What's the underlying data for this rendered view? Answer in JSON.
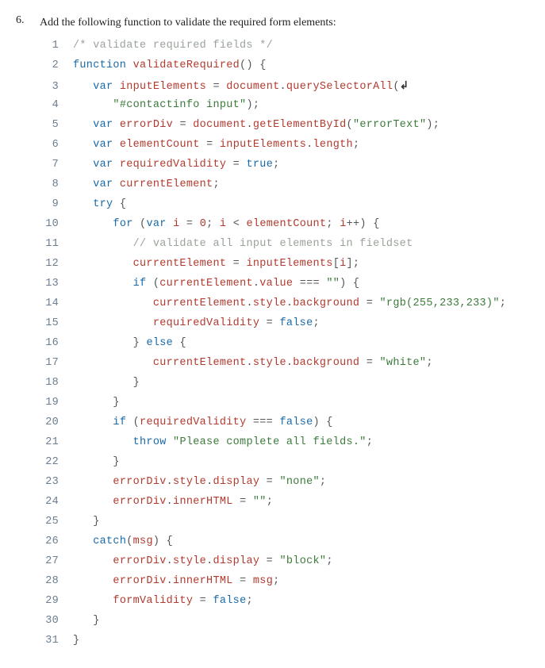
{
  "step": {
    "number": "6.",
    "instruction": "Add the following function to validate the required form elements:"
  },
  "code": {
    "lines": [
      {
        "n": "1",
        "tokens": [
          {
            "cls": "t-comment",
            "txt": "/* validate required fields */"
          }
        ]
      },
      {
        "n": "2",
        "tokens": [
          {
            "cls": "t-keyword",
            "txt": "function"
          },
          {
            "cls": "t-punct",
            "txt": " "
          },
          {
            "cls": "t-func",
            "txt": "validateRequired"
          },
          {
            "cls": "t-punct",
            "txt": "() {"
          }
        ]
      },
      {
        "n": "3",
        "tokens": [
          {
            "cls": "",
            "txt": "   "
          },
          {
            "cls": "t-var",
            "txt": "var"
          },
          {
            "cls": "t-punct",
            "txt": " "
          },
          {
            "cls": "t-ident",
            "txt": "inputElements"
          },
          {
            "cls": "t-punct",
            "txt": " = "
          },
          {
            "cls": "t-attr",
            "txt": "document"
          },
          {
            "cls": "t-punct",
            "txt": "."
          },
          {
            "cls": "t-attr",
            "txt": "querySelectorAll"
          },
          {
            "cls": "t-punct",
            "txt": "("
          },
          {
            "cls": "wrap-icon",
            "txt": "↲"
          }
        ]
      },
      {
        "n": "4",
        "tokens": [
          {
            "cls": "",
            "txt": "      "
          },
          {
            "cls": "t-str",
            "txt": "\"#contactinfo input\""
          },
          {
            "cls": "t-punct",
            "txt": ");"
          }
        ]
      },
      {
        "n": "5",
        "tokens": [
          {
            "cls": "",
            "txt": "   "
          },
          {
            "cls": "t-var",
            "txt": "var"
          },
          {
            "cls": "t-punct",
            "txt": " "
          },
          {
            "cls": "t-ident",
            "txt": "errorDiv"
          },
          {
            "cls": "t-punct",
            "txt": " = "
          },
          {
            "cls": "t-attr",
            "txt": "document"
          },
          {
            "cls": "t-punct",
            "txt": "."
          },
          {
            "cls": "t-attr",
            "txt": "getElementById"
          },
          {
            "cls": "t-punct",
            "txt": "("
          },
          {
            "cls": "t-str",
            "txt": "\"errorText\""
          },
          {
            "cls": "t-punct",
            "txt": ");"
          }
        ]
      },
      {
        "n": "6",
        "tokens": [
          {
            "cls": "",
            "txt": "   "
          },
          {
            "cls": "t-var",
            "txt": "var"
          },
          {
            "cls": "t-punct",
            "txt": " "
          },
          {
            "cls": "t-ident",
            "txt": "elementCount"
          },
          {
            "cls": "t-punct",
            "txt": " = "
          },
          {
            "cls": "t-attr",
            "txt": "inputElements"
          },
          {
            "cls": "t-punct",
            "txt": "."
          },
          {
            "cls": "t-attr",
            "txt": "length"
          },
          {
            "cls": "t-punct",
            "txt": ";"
          }
        ]
      },
      {
        "n": "7",
        "tokens": [
          {
            "cls": "",
            "txt": "   "
          },
          {
            "cls": "t-var",
            "txt": "var"
          },
          {
            "cls": "t-punct",
            "txt": " "
          },
          {
            "cls": "t-ident",
            "txt": "requiredValidity"
          },
          {
            "cls": "t-punct",
            "txt": " = "
          },
          {
            "cls": "t-bool",
            "txt": "true"
          },
          {
            "cls": "t-punct",
            "txt": ";"
          }
        ]
      },
      {
        "n": "8",
        "tokens": [
          {
            "cls": "",
            "txt": "   "
          },
          {
            "cls": "t-var",
            "txt": "var"
          },
          {
            "cls": "t-punct",
            "txt": " "
          },
          {
            "cls": "t-ident",
            "txt": "currentElement"
          },
          {
            "cls": "t-punct",
            "txt": ";"
          }
        ]
      },
      {
        "n": "9",
        "tokens": [
          {
            "cls": "",
            "txt": "   "
          },
          {
            "cls": "t-keyword",
            "txt": "try"
          },
          {
            "cls": "t-punct",
            "txt": " {"
          }
        ]
      },
      {
        "n": "10",
        "tokens": [
          {
            "cls": "",
            "txt": "      "
          },
          {
            "cls": "t-keyword",
            "txt": "for"
          },
          {
            "cls": "t-punct",
            "txt": " ("
          },
          {
            "cls": "t-var",
            "txt": "var"
          },
          {
            "cls": "t-punct",
            "txt": " "
          },
          {
            "cls": "t-ident",
            "txt": "i"
          },
          {
            "cls": "t-punct",
            "txt": " = "
          },
          {
            "cls": "t-num",
            "txt": "0"
          },
          {
            "cls": "t-punct",
            "txt": "; "
          },
          {
            "cls": "t-ident",
            "txt": "i"
          },
          {
            "cls": "t-punct",
            "txt": " < "
          },
          {
            "cls": "t-ident",
            "txt": "elementCount"
          },
          {
            "cls": "t-punct",
            "txt": "; "
          },
          {
            "cls": "t-ident",
            "txt": "i"
          },
          {
            "cls": "t-punct",
            "txt": "++) {"
          }
        ]
      },
      {
        "n": "11",
        "tokens": [
          {
            "cls": "",
            "txt": "         "
          },
          {
            "cls": "t-comment",
            "txt": "// validate all input elements in fieldset"
          }
        ]
      },
      {
        "n": "12",
        "tokens": [
          {
            "cls": "",
            "txt": "         "
          },
          {
            "cls": "t-ident",
            "txt": "currentElement"
          },
          {
            "cls": "t-punct",
            "txt": " = "
          },
          {
            "cls": "t-attr",
            "txt": "inputElements"
          },
          {
            "cls": "t-punct",
            "txt": "["
          },
          {
            "cls": "t-ident",
            "txt": "i"
          },
          {
            "cls": "t-punct",
            "txt": "];"
          }
        ]
      },
      {
        "n": "13",
        "tokens": [
          {
            "cls": "",
            "txt": "         "
          },
          {
            "cls": "t-keyword",
            "txt": "if"
          },
          {
            "cls": "t-punct",
            "txt": " ("
          },
          {
            "cls": "t-attr",
            "txt": "currentElement"
          },
          {
            "cls": "t-punct",
            "txt": "."
          },
          {
            "cls": "t-attr",
            "txt": "value"
          },
          {
            "cls": "t-punct",
            "txt": " === "
          },
          {
            "cls": "t-str",
            "txt": "\"\""
          },
          {
            "cls": "t-punct",
            "txt": ") {"
          }
        ]
      },
      {
        "n": "14",
        "tokens": [
          {
            "cls": "",
            "txt": "            "
          },
          {
            "cls": "t-attr",
            "txt": "currentElement"
          },
          {
            "cls": "t-punct",
            "txt": "."
          },
          {
            "cls": "t-attr",
            "txt": "style"
          },
          {
            "cls": "t-punct",
            "txt": "."
          },
          {
            "cls": "t-attr",
            "txt": "background"
          },
          {
            "cls": "t-punct",
            "txt": " = "
          },
          {
            "cls": "t-str",
            "txt": "\"rgb(255,233,233)\""
          },
          {
            "cls": "t-punct",
            "txt": ";"
          }
        ]
      },
      {
        "n": "15",
        "tokens": [
          {
            "cls": "",
            "txt": "            "
          },
          {
            "cls": "t-ident",
            "txt": "requiredValidity"
          },
          {
            "cls": "t-punct",
            "txt": " = "
          },
          {
            "cls": "t-bool",
            "txt": "false"
          },
          {
            "cls": "t-punct",
            "txt": ";"
          }
        ]
      },
      {
        "n": "16",
        "tokens": [
          {
            "cls": "",
            "txt": "         "
          },
          {
            "cls": "t-punct",
            "txt": "} "
          },
          {
            "cls": "t-keyword",
            "txt": "else"
          },
          {
            "cls": "t-punct",
            "txt": " {"
          }
        ]
      },
      {
        "n": "17",
        "tokens": [
          {
            "cls": "",
            "txt": "            "
          },
          {
            "cls": "t-attr",
            "txt": "currentElement"
          },
          {
            "cls": "t-punct",
            "txt": "."
          },
          {
            "cls": "t-attr",
            "txt": "style"
          },
          {
            "cls": "t-punct",
            "txt": "."
          },
          {
            "cls": "t-attr",
            "txt": "background"
          },
          {
            "cls": "t-punct",
            "txt": " = "
          },
          {
            "cls": "t-str",
            "txt": "\"white\""
          },
          {
            "cls": "t-punct",
            "txt": ";"
          }
        ]
      },
      {
        "n": "18",
        "tokens": [
          {
            "cls": "",
            "txt": "         "
          },
          {
            "cls": "t-punct",
            "txt": "}"
          }
        ]
      },
      {
        "n": "19",
        "tokens": [
          {
            "cls": "",
            "txt": "      "
          },
          {
            "cls": "t-punct",
            "txt": "}"
          }
        ]
      },
      {
        "n": "20",
        "tokens": [
          {
            "cls": "",
            "txt": "      "
          },
          {
            "cls": "t-keyword",
            "txt": "if"
          },
          {
            "cls": "t-punct",
            "txt": " ("
          },
          {
            "cls": "t-ident",
            "txt": "requiredValidity"
          },
          {
            "cls": "t-punct",
            "txt": " === "
          },
          {
            "cls": "t-bool",
            "txt": "false"
          },
          {
            "cls": "t-punct",
            "txt": ") {"
          }
        ]
      },
      {
        "n": "21",
        "tokens": [
          {
            "cls": "",
            "txt": "         "
          },
          {
            "cls": "t-keyword",
            "txt": "throw"
          },
          {
            "cls": "t-punct",
            "txt": " "
          },
          {
            "cls": "t-str",
            "txt": "\"Please complete all fields.\""
          },
          {
            "cls": "t-punct",
            "txt": ";"
          }
        ]
      },
      {
        "n": "22",
        "tokens": [
          {
            "cls": "",
            "txt": "      "
          },
          {
            "cls": "t-punct",
            "txt": "}"
          }
        ]
      },
      {
        "n": "23",
        "tokens": [
          {
            "cls": "",
            "txt": "      "
          },
          {
            "cls": "t-attr",
            "txt": "errorDiv"
          },
          {
            "cls": "t-punct",
            "txt": "."
          },
          {
            "cls": "t-attr",
            "txt": "style"
          },
          {
            "cls": "t-punct",
            "txt": "."
          },
          {
            "cls": "t-attr",
            "txt": "display"
          },
          {
            "cls": "t-punct",
            "txt": " = "
          },
          {
            "cls": "t-str",
            "txt": "\"none\""
          },
          {
            "cls": "t-punct",
            "txt": ";"
          }
        ]
      },
      {
        "n": "24",
        "tokens": [
          {
            "cls": "",
            "txt": "      "
          },
          {
            "cls": "t-attr",
            "txt": "errorDiv"
          },
          {
            "cls": "t-punct",
            "txt": "."
          },
          {
            "cls": "t-attr",
            "txt": "innerHTML"
          },
          {
            "cls": "t-punct",
            "txt": " = "
          },
          {
            "cls": "t-str",
            "txt": "\"\""
          },
          {
            "cls": "t-punct",
            "txt": ";"
          }
        ]
      },
      {
        "n": "25",
        "tokens": [
          {
            "cls": "",
            "txt": "   "
          },
          {
            "cls": "t-punct",
            "txt": "}"
          }
        ]
      },
      {
        "n": "26",
        "tokens": [
          {
            "cls": "",
            "txt": "   "
          },
          {
            "cls": "t-keyword",
            "txt": "catch"
          },
          {
            "cls": "t-punct",
            "txt": "("
          },
          {
            "cls": "t-ident",
            "txt": "msg"
          },
          {
            "cls": "t-punct",
            "txt": ") {"
          }
        ]
      },
      {
        "n": "27",
        "tokens": [
          {
            "cls": "",
            "txt": "      "
          },
          {
            "cls": "t-attr",
            "txt": "errorDiv"
          },
          {
            "cls": "t-punct",
            "txt": "."
          },
          {
            "cls": "t-attr",
            "txt": "style"
          },
          {
            "cls": "t-punct",
            "txt": "."
          },
          {
            "cls": "t-attr",
            "txt": "display"
          },
          {
            "cls": "t-punct",
            "txt": " = "
          },
          {
            "cls": "t-str",
            "txt": "\"block\""
          },
          {
            "cls": "t-punct",
            "txt": ";"
          }
        ]
      },
      {
        "n": "28",
        "tokens": [
          {
            "cls": "",
            "txt": "      "
          },
          {
            "cls": "t-attr",
            "txt": "errorDiv"
          },
          {
            "cls": "t-punct",
            "txt": "."
          },
          {
            "cls": "t-attr",
            "txt": "innerHTML"
          },
          {
            "cls": "t-punct",
            "txt": " = "
          },
          {
            "cls": "t-ident",
            "txt": "msg"
          },
          {
            "cls": "t-punct",
            "txt": ";"
          }
        ]
      },
      {
        "n": "29",
        "tokens": [
          {
            "cls": "",
            "txt": "      "
          },
          {
            "cls": "t-ident",
            "txt": "formValidity"
          },
          {
            "cls": "t-punct",
            "txt": " = "
          },
          {
            "cls": "t-bool",
            "txt": "false"
          },
          {
            "cls": "t-punct",
            "txt": ";"
          }
        ]
      },
      {
        "n": "30",
        "tokens": [
          {
            "cls": "",
            "txt": "   "
          },
          {
            "cls": "t-punct",
            "txt": "}"
          }
        ]
      },
      {
        "n": "31",
        "tokens": [
          {
            "cls": "t-punct",
            "txt": "}"
          }
        ]
      }
    ]
  }
}
